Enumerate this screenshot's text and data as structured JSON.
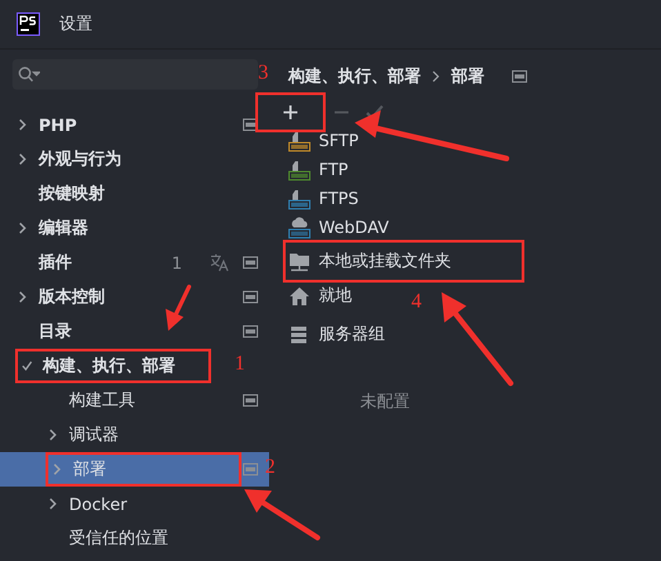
{
  "window": {
    "title": "设置"
  },
  "sidebar": {
    "items": [
      {
        "label": "PHP",
        "expandable": true,
        "expanded": false,
        "selected": false,
        "project_scoped": true
      },
      {
        "label": "外观与行为",
        "expandable": true,
        "expanded": false,
        "selected": false,
        "project_scoped": false
      },
      {
        "label": "按键映射",
        "expandable": false,
        "selected": false,
        "project_scoped": false
      },
      {
        "label": "编辑器",
        "expandable": true,
        "expanded": false,
        "selected": false,
        "project_scoped": false
      },
      {
        "label": "插件",
        "expandable": false,
        "selected": false,
        "project_scoped": true,
        "count": "1",
        "translatable": true
      },
      {
        "label": "版本控制",
        "expandable": true,
        "expanded": false,
        "selected": false,
        "project_scoped": true
      },
      {
        "label": "目录",
        "expandable": false,
        "selected": false,
        "project_scoped": true
      },
      {
        "label": "构建、执行、部署",
        "expandable": true,
        "expanded": true,
        "selected": false,
        "project_scoped": false,
        "callout": "1",
        "children": [
          {
            "label": "构建工具",
            "expandable": false,
            "selected": false,
            "project_scoped": true
          },
          {
            "label": "调试器",
            "expandable": true,
            "expanded": false,
            "selected": false,
            "project_scoped": false
          },
          {
            "label": "部署",
            "expandable": true,
            "expanded": false,
            "selected": true,
            "project_scoped": true,
            "callout": "2"
          },
          {
            "label": "Docker",
            "expandable": true,
            "expanded": false,
            "selected": false,
            "project_scoped": false
          },
          {
            "label": "受信任的位置",
            "expandable": false,
            "selected": false,
            "project_scoped": false
          }
        ]
      }
    ]
  },
  "panel": {
    "breadcrumb": [
      "构建、执行、部署",
      "部署"
    ],
    "project_scoped": true,
    "toolbar": [
      {
        "kind": "add",
        "disabled": false,
        "callout": "3"
      },
      {
        "kind": "remove",
        "disabled": true
      },
      {
        "kind": "apply",
        "disabled": true
      }
    ],
    "add_menu": [
      {
        "kind": "sftp",
        "label": "SFTP"
      },
      {
        "kind": "ftp",
        "label": "FTP"
      },
      {
        "kind": "ftps",
        "label": "FTPS"
      },
      {
        "kind": "webdav",
        "label": "WebDAV"
      },
      {
        "kind": "local",
        "label": "本地或挂载文件夹",
        "callout": "4"
      },
      {
        "kind": "inplace",
        "label": "就地"
      },
      {
        "kind": "group",
        "label": "服务器组"
      }
    ],
    "empty_text": "未配置"
  }
}
